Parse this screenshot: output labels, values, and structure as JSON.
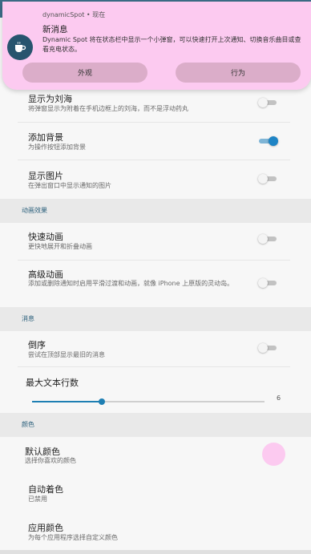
{
  "status_bar": {
    "leading": "1"
  },
  "notification": {
    "app_line": "dynamicSpot • 现在",
    "icon": "coffee-cup-icon",
    "title": "新消息",
    "body": "Dynamic Spot 将在状态栏中显示一个小弹窗，可以快速打开上次通知、切换音乐曲目或查看充电状态。",
    "actions": [
      "外观",
      "行为"
    ],
    "color": "#fccaf0"
  },
  "settings": {
    "show_as_notch": {
      "title": "显示为刘海",
      "subtitle": "将弹窗显示为附着在手机边框上的刘海，而不是浮动药丸",
      "enabled": false
    },
    "add_background": {
      "title": "添加背景",
      "subtitle": "为操作按钮添加背景",
      "enabled": true
    },
    "show_image": {
      "title": "显示图片",
      "subtitle": "在弹出窗口中显示通知的图片",
      "enabled": false
    },
    "animation_header": "动画效果",
    "fast_animation": {
      "title": "快速动画",
      "subtitle": "更快地展开和折叠动画",
      "enabled": false
    },
    "advanced_animation": {
      "title": "高级动画",
      "subtitle": "添加或删除通知时启用平滑过渡和动画，就像 iPhone 上原版的灵动岛。",
      "enabled": false
    },
    "message_header": "消息",
    "reverse_order": {
      "title": "倒序",
      "subtitle": "尝试在顶部显示最旧的消息",
      "enabled": false
    },
    "max_lines": {
      "title": "最大文本行数",
      "value": "6",
      "fraction": 0.3
    },
    "color_header": "颜色",
    "default_color": {
      "title": "默认颜色",
      "subtitle": "选择你喜欢的颜色",
      "color": "#fccaf0"
    },
    "auto_color": {
      "title": "自动着色",
      "subtitle": "已禁用"
    },
    "app_color": {
      "title": "应用颜色",
      "subtitle": "为每个应用程序选择自定义颜色"
    }
  },
  "colors": {
    "accent": "#1e84c5",
    "header_text": "#2a5f7b",
    "status_bar": "#3b6c87"
  }
}
